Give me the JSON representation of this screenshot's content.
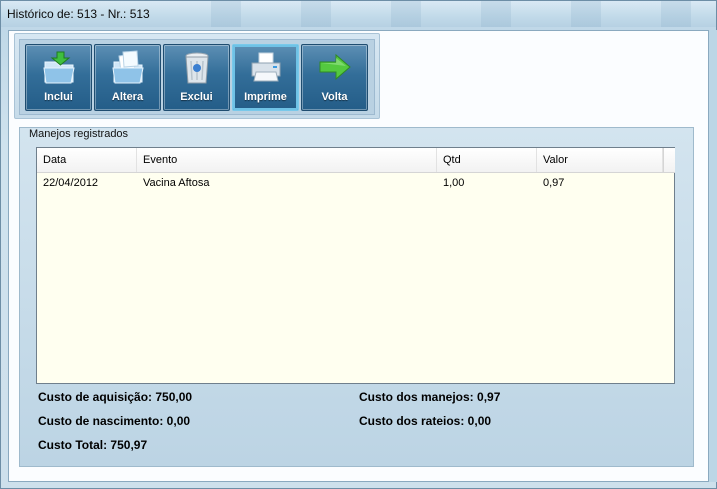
{
  "window": {
    "title": "Histórico de: 513 - Nr.: 513"
  },
  "toolbar": {
    "buttons": [
      {
        "label": "Inclui",
        "icon": "add-folder-icon"
      },
      {
        "label": "Altera",
        "icon": "edit-folder-icon"
      },
      {
        "label": "Exclui",
        "icon": "trash-icon"
      },
      {
        "label": "Imprime",
        "icon": "printer-icon"
      },
      {
        "label": "Volta",
        "icon": "arrow-right-icon"
      }
    ]
  },
  "group": {
    "title": "Manejos registrados"
  },
  "grid": {
    "columns": [
      "Data",
      "Evento",
      "Qtd",
      "Valor"
    ],
    "rows": [
      [
        "22/04/2012",
        "Vacina Aftosa",
        "1,00",
        "0,97"
      ]
    ]
  },
  "summary": {
    "custo_aquisicao": "Custo de aquisição: 750,00",
    "custo_nascimento": "Custo de nascimento: 0,00",
    "custo_total": "Custo Total: 750,97",
    "custo_manejos": "Custo dos manejos: 0,97",
    "custo_rateios": "Custo dos rateios: 0,00"
  },
  "colors": {
    "button_blue": "#336e99",
    "button_active_border": "#6fc2e6",
    "grid_background": "#fffff0"
  }
}
